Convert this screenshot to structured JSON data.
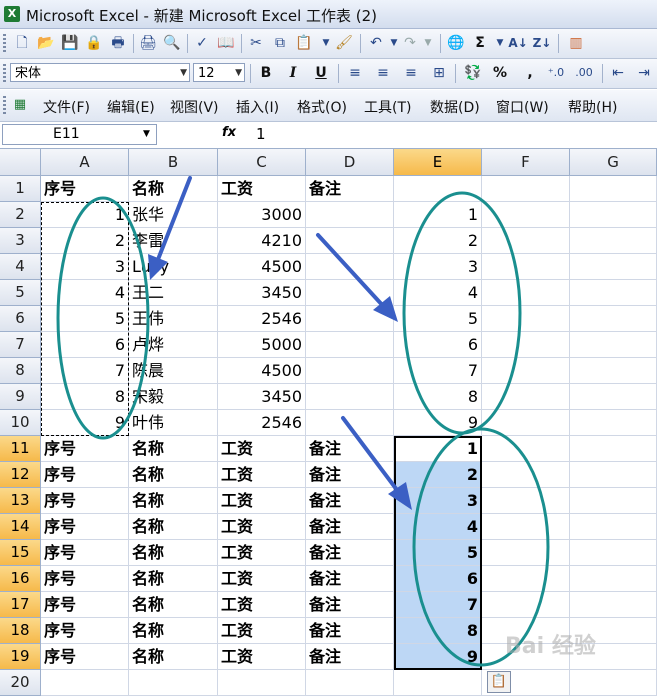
{
  "window": {
    "title": "Microsoft Excel - 新建 Microsoft Excel 工作表 (2)",
    "app_icon": "excel-icon"
  },
  "toolbar_standard": {
    "icons": [
      "new-icon",
      "open-icon",
      "save-icon",
      "permission-icon",
      "print-icon",
      "print-preview-icon",
      "spelling-icon",
      "research-icon",
      "cut-icon",
      "copy-icon",
      "paste-icon",
      "format-painter-icon",
      "undo-icon",
      "redo-icon",
      "hyperlink-icon",
      "autosum-icon",
      "sort-ascending-icon",
      "sort-descending-icon",
      "chart-wizard-icon"
    ],
    "autosum_label": "Σ"
  },
  "toolbar_formatting": {
    "font": "宋体",
    "size": "12",
    "bold": "B",
    "italic": "I",
    "underline": "U",
    "percent": "%",
    "comma": ","
  },
  "menu": [
    "文件(F)",
    "编辑(E)",
    "视图(V)",
    "插入(I)",
    "格式(O)",
    "工具(T)",
    "数据(D)",
    "窗口(W)",
    "帮助(H)"
  ],
  "formula_bar": {
    "name_box": "E11",
    "fx": "fx",
    "value": "1"
  },
  "columns": [
    "A",
    "B",
    "C",
    "D",
    "E",
    "F",
    "G"
  ],
  "rows": [
    {
      "n": "1",
      "a": "序号",
      "b": "名称",
      "c": "工资",
      "d": "备注",
      "e": "",
      "bold": true
    },
    {
      "n": "2",
      "a": "1",
      "b": "张华",
      "c": "3000",
      "d": "",
      "e": "1"
    },
    {
      "n": "3",
      "a": "2",
      "b": "李雷",
      "c": "4210",
      "d": "",
      "e": "2"
    },
    {
      "n": "4",
      "a": "3",
      "b": "Lucy",
      "c": "4500",
      "d": "",
      "e": "3"
    },
    {
      "n": "5",
      "a": "4",
      "b": "王二",
      "c": "3450",
      "d": "",
      "e": "4"
    },
    {
      "n": "6",
      "a": "5",
      "b": "王伟",
      "c": "2546",
      "d": "",
      "e": "5"
    },
    {
      "n": "7",
      "a": "6",
      "b": "卢烨",
      "c": "5000",
      "d": "",
      "e": "6"
    },
    {
      "n": "8",
      "a": "7",
      "b": "陈晨",
      "c": "4500",
      "d": "",
      "e": "7"
    },
    {
      "n": "9",
      "a": "8",
      "b": "宋毅",
      "c": "3450",
      "d": "",
      "e": "8"
    },
    {
      "n": "10",
      "a": "9",
      "b": "叶伟",
      "c": "2546",
      "d": "",
      "e": "9"
    },
    {
      "n": "11",
      "a": "序号",
      "b": "名称",
      "c": "工资",
      "d": "备注",
      "e": "1",
      "bold": true
    },
    {
      "n": "12",
      "a": "序号",
      "b": "名称",
      "c": "工资",
      "d": "备注",
      "e": "2",
      "bold": true
    },
    {
      "n": "13",
      "a": "序号",
      "b": "名称",
      "c": "工资",
      "d": "备注",
      "e": "3",
      "bold": true
    },
    {
      "n": "14",
      "a": "序号",
      "b": "名称",
      "c": "工资",
      "d": "备注",
      "e": "4",
      "bold": true
    },
    {
      "n": "15",
      "a": "序号",
      "b": "名称",
      "c": "工资",
      "d": "备注",
      "e": "5",
      "bold": true
    },
    {
      "n": "16",
      "a": "序号",
      "b": "名称",
      "c": "工资",
      "d": "备注",
      "e": "6",
      "bold": true
    },
    {
      "n": "17",
      "a": "序号",
      "b": "名称",
      "c": "工资",
      "d": "备注",
      "e": "7",
      "bold": true
    },
    {
      "n": "18",
      "a": "序号",
      "b": "名称",
      "c": "工资",
      "d": "备注",
      "e": "8",
      "bold": true
    },
    {
      "n": "19",
      "a": "序号",
      "b": "名称",
      "c": "工资",
      "d": "备注",
      "e": "9",
      "bold": true
    },
    {
      "n": "20",
      "a": "",
      "b": "",
      "c": "",
      "d": "",
      "e": ""
    }
  ],
  "selection": {
    "active_column": "E",
    "active_rows": [
      "11",
      "12",
      "13",
      "14",
      "15",
      "16",
      "17",
      "18",
      "19"
    ]
  },
  "colors": {
    "annotation_ellipse": "#1a8f8f",
    "annotation_arrow": "#3b5fc4",
    "selection_fill": "#bdd7f5",
    "header_highlight": "#f6b94a"
  },
  "paste_options_icon": "paste-options-icon",
  "watermark": "Bai 经验"
}
